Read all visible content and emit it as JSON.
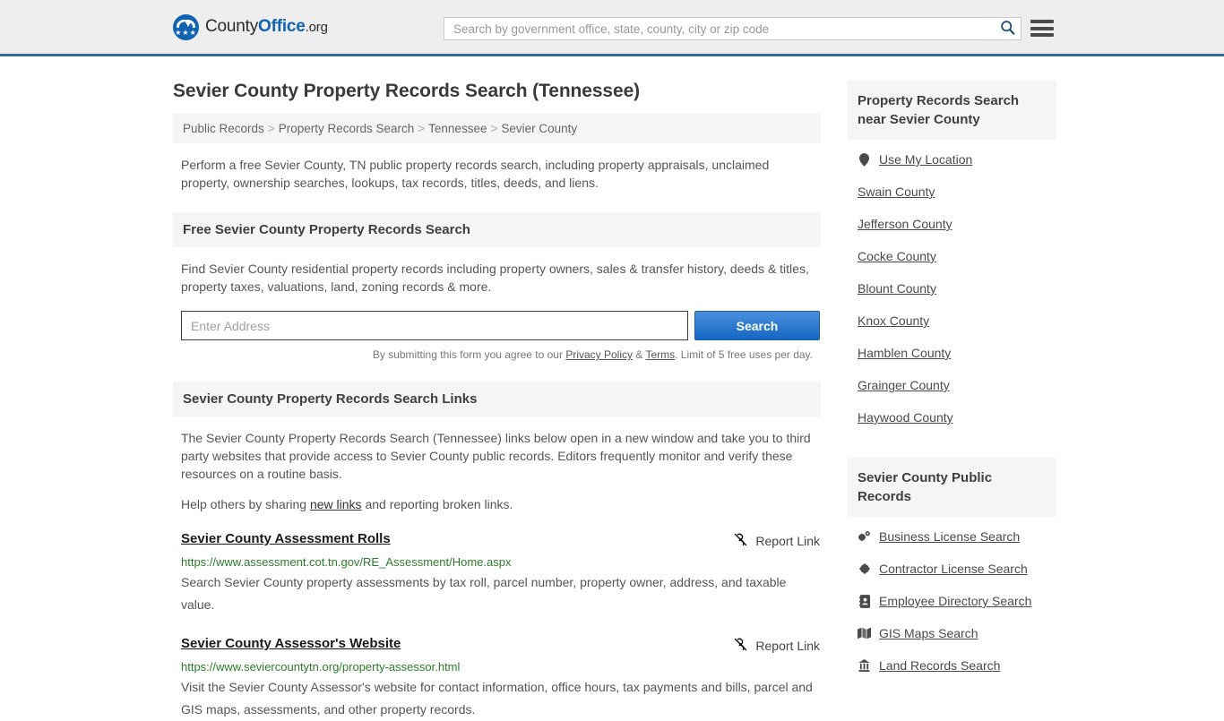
{
  "header": {
    "logo": {
      "part1": "County",
      "part2": "Office",
      "part3": ".org"
    },
    "search_placeholder": "Search by government office, state, county, city or zip code",
    "search_value": "",
    "search_icon": "search-icon",
    "menu_icon": "hamburger-menu-icon"
  },
  "main": {
    "title": "Sevier County Property Records Search (Tennessee)",
    "breadcrumb": [
      "Public Records",
      "Property Records Search",
      "Tennessee",
      "Sevier County"
    ],
    "breadcrumb_separator": ">",
    "intro": "Perform a free Sevier County, TN public property records search, including property appraisals, unclaimed property, ownership searches, lookups, tax records, titles, deeds, and liens.",
    "free_search": {
      "heading": "Free Sevier County Property Records Search",
      "description": "Find Sevier County residential property records including property owners, sales & transfer history, deeds & titles, property taxes, valuations, land, zoning records & more.",
      "input_placeholder": "Enter Address",
      "input_value": "",
      "button_label": "Search",
      "disclaimer_pre": "By submitting this form you agree to our ",
      "disclaimer_privacy": "Privacy Policy",
      "disclaimer_amp": " & ",
      "disclaimer_terms": "Terms",
      "disclaimer_post": ". Limit of 5 free uses per day."
    },
    "links_section": {
      "heading": "Sevier County Property Records Search Links",
      "description": "The Sevier County Property Records Search (Tennessee) links below open in a new window and take you to third party websites that provide access to Sevier County public records. Editors frequently monitor and verify these resources on a routine basis.",
      "help_pre": "Help others by sharing ",
      "help_link": "new links",
      "help_post": " and reporting broken links.",
      "report_label": "Report Link",
      "report_icon": "unlink-icon"
    },
    "results": [
      {
        "title": "Sevier County Assessment Rolls",
        "url": "https://www.assessment.cot.tn.gov/RE_Assessment/Home.aspx",
        "description": "Search Sevier County property assessments by tax roll, parcel number, property owner, address, and taxable value.",
        "report_label": "Report Link"
      },
      {
        "title": "Sevier County Assessor's Website",
        "url": "https://www.seviercountytn.org/property-assessor.html",
        "description": "Visit the Sevier County Assessor's website for contact information, office hours, tax payments and bills, parcel and GIS maps, assessments, and other property records.",
        "report_label": "Report Link"
      }
    ]
  },
  "sidebar": {
    "nearby": {
      "heading": "Property Records Search near Sevier County",
      "items": [
        {
          "label": "Use My Location",
          "icon": "map-pin-icon"
        },
        {
          "label": "Swain County",
          "icon": ""
        },
        {
          "label": "Jefferson County",
          "icon": ""
        },
        {
          "label": "Cocke County",
          "icon": ""
        },
        {
          "label": "Blount County",
          "icon": ""
        },
        {
          "label": "Knox County",
          "icon": ""
        },
        {
          "label": "Hamblen County",
          "icon": ""
        },
        {
          "label": "Grainger County",
          "icon": ""
        },
        {
          "label": "Haywood County",
          "icon": ""
        }
      ]
    },
    "public_records": {
      "heading": "Sevier County Public Records",
      "items": [
        {
          "label": "Business License Search",
          "icon": "cogs-icon"
        },
        {
          "label": "Contractor License Search",
          "icon": "cog-icon"
        },
        {
          "label": "Employee Directory Search",
          "icon": "address-book-icon"
        },
        {
          "label": "GIS Maps Search",
          "icon": "map-icon"
        },
        {
          "label": "Land Records Search",
          "icon": "landmark-icon"
        }
      ]
    }
  },
  "colors": {
    "brand_blue": "#1262b3",
    "header_bg": "#eeeeee",
    "header_border": "#33699e",
    "panel_bg": "#f5f5f5",
    "url_green": "#2a7d2a",
    "button_blue": "#1466c3"
  }
}
